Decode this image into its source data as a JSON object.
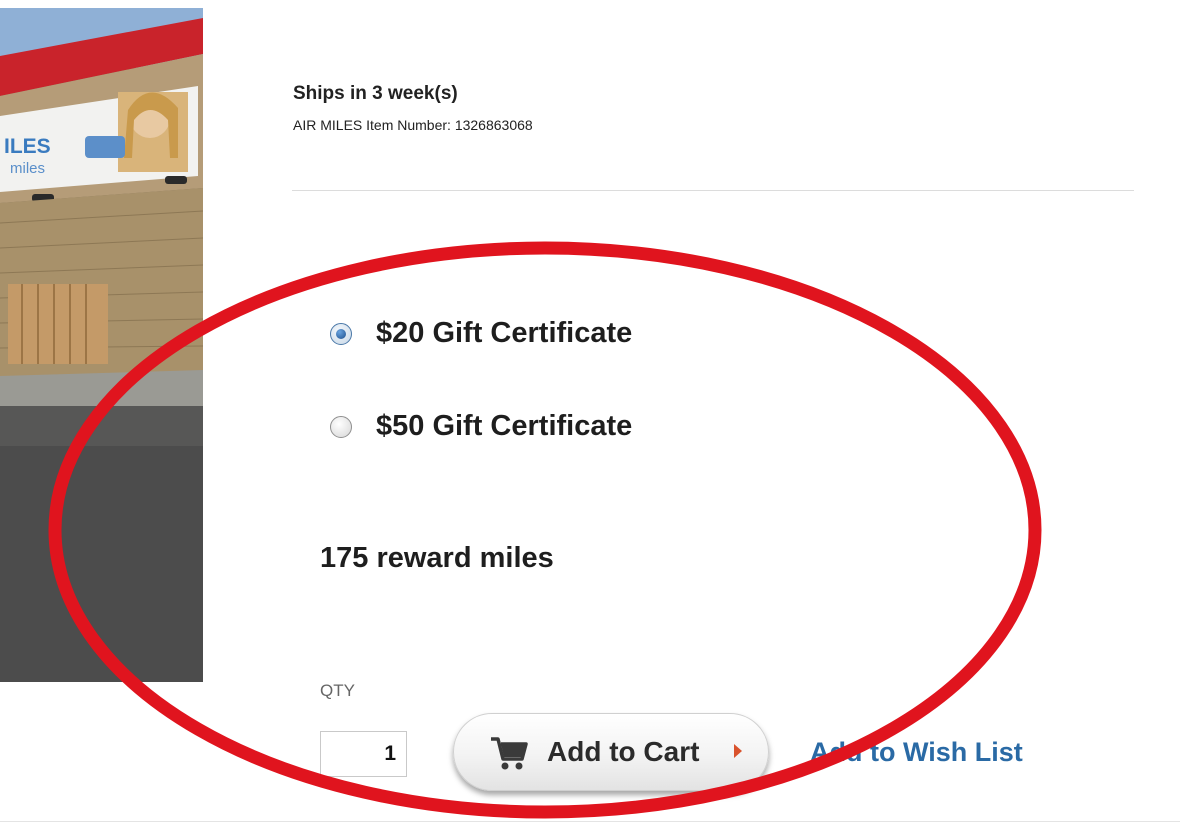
{
  "product": {
    "shipping": "Ships in 3 week(s)",
    "item_number": "AIR MILES Item Number: 1326863068",
    "photo_sign_text_1": "ILES",
    "photo_sign_text_2": "miles"
  },
  "options": [
    {
      "label": "$20 Gift Certificate",
      "selected": true
    },
    {
      "label": "$50 Gift Certificate",
      "selected": false
    }
  ],
  "price": "175  reward miles",
  "purchase": {
    "qty_label": "QTY",
    "qty_value": "1",
    "add_to_cart_label": "Add to Cart",
    "wish_list_label": "Add to Wish List"
  },
  "icons": {
    "cart": "cart-icon",
    "chevron": "chevron-right-icon",
    "radio": "radio-icon"
  },
  "colors": {
    "annotation": "#e0141e",
    "link": "#2a6aa5",
    "chevron": "#d9522c",
    "radio_selected": "#1d4f8c"
  }
}
